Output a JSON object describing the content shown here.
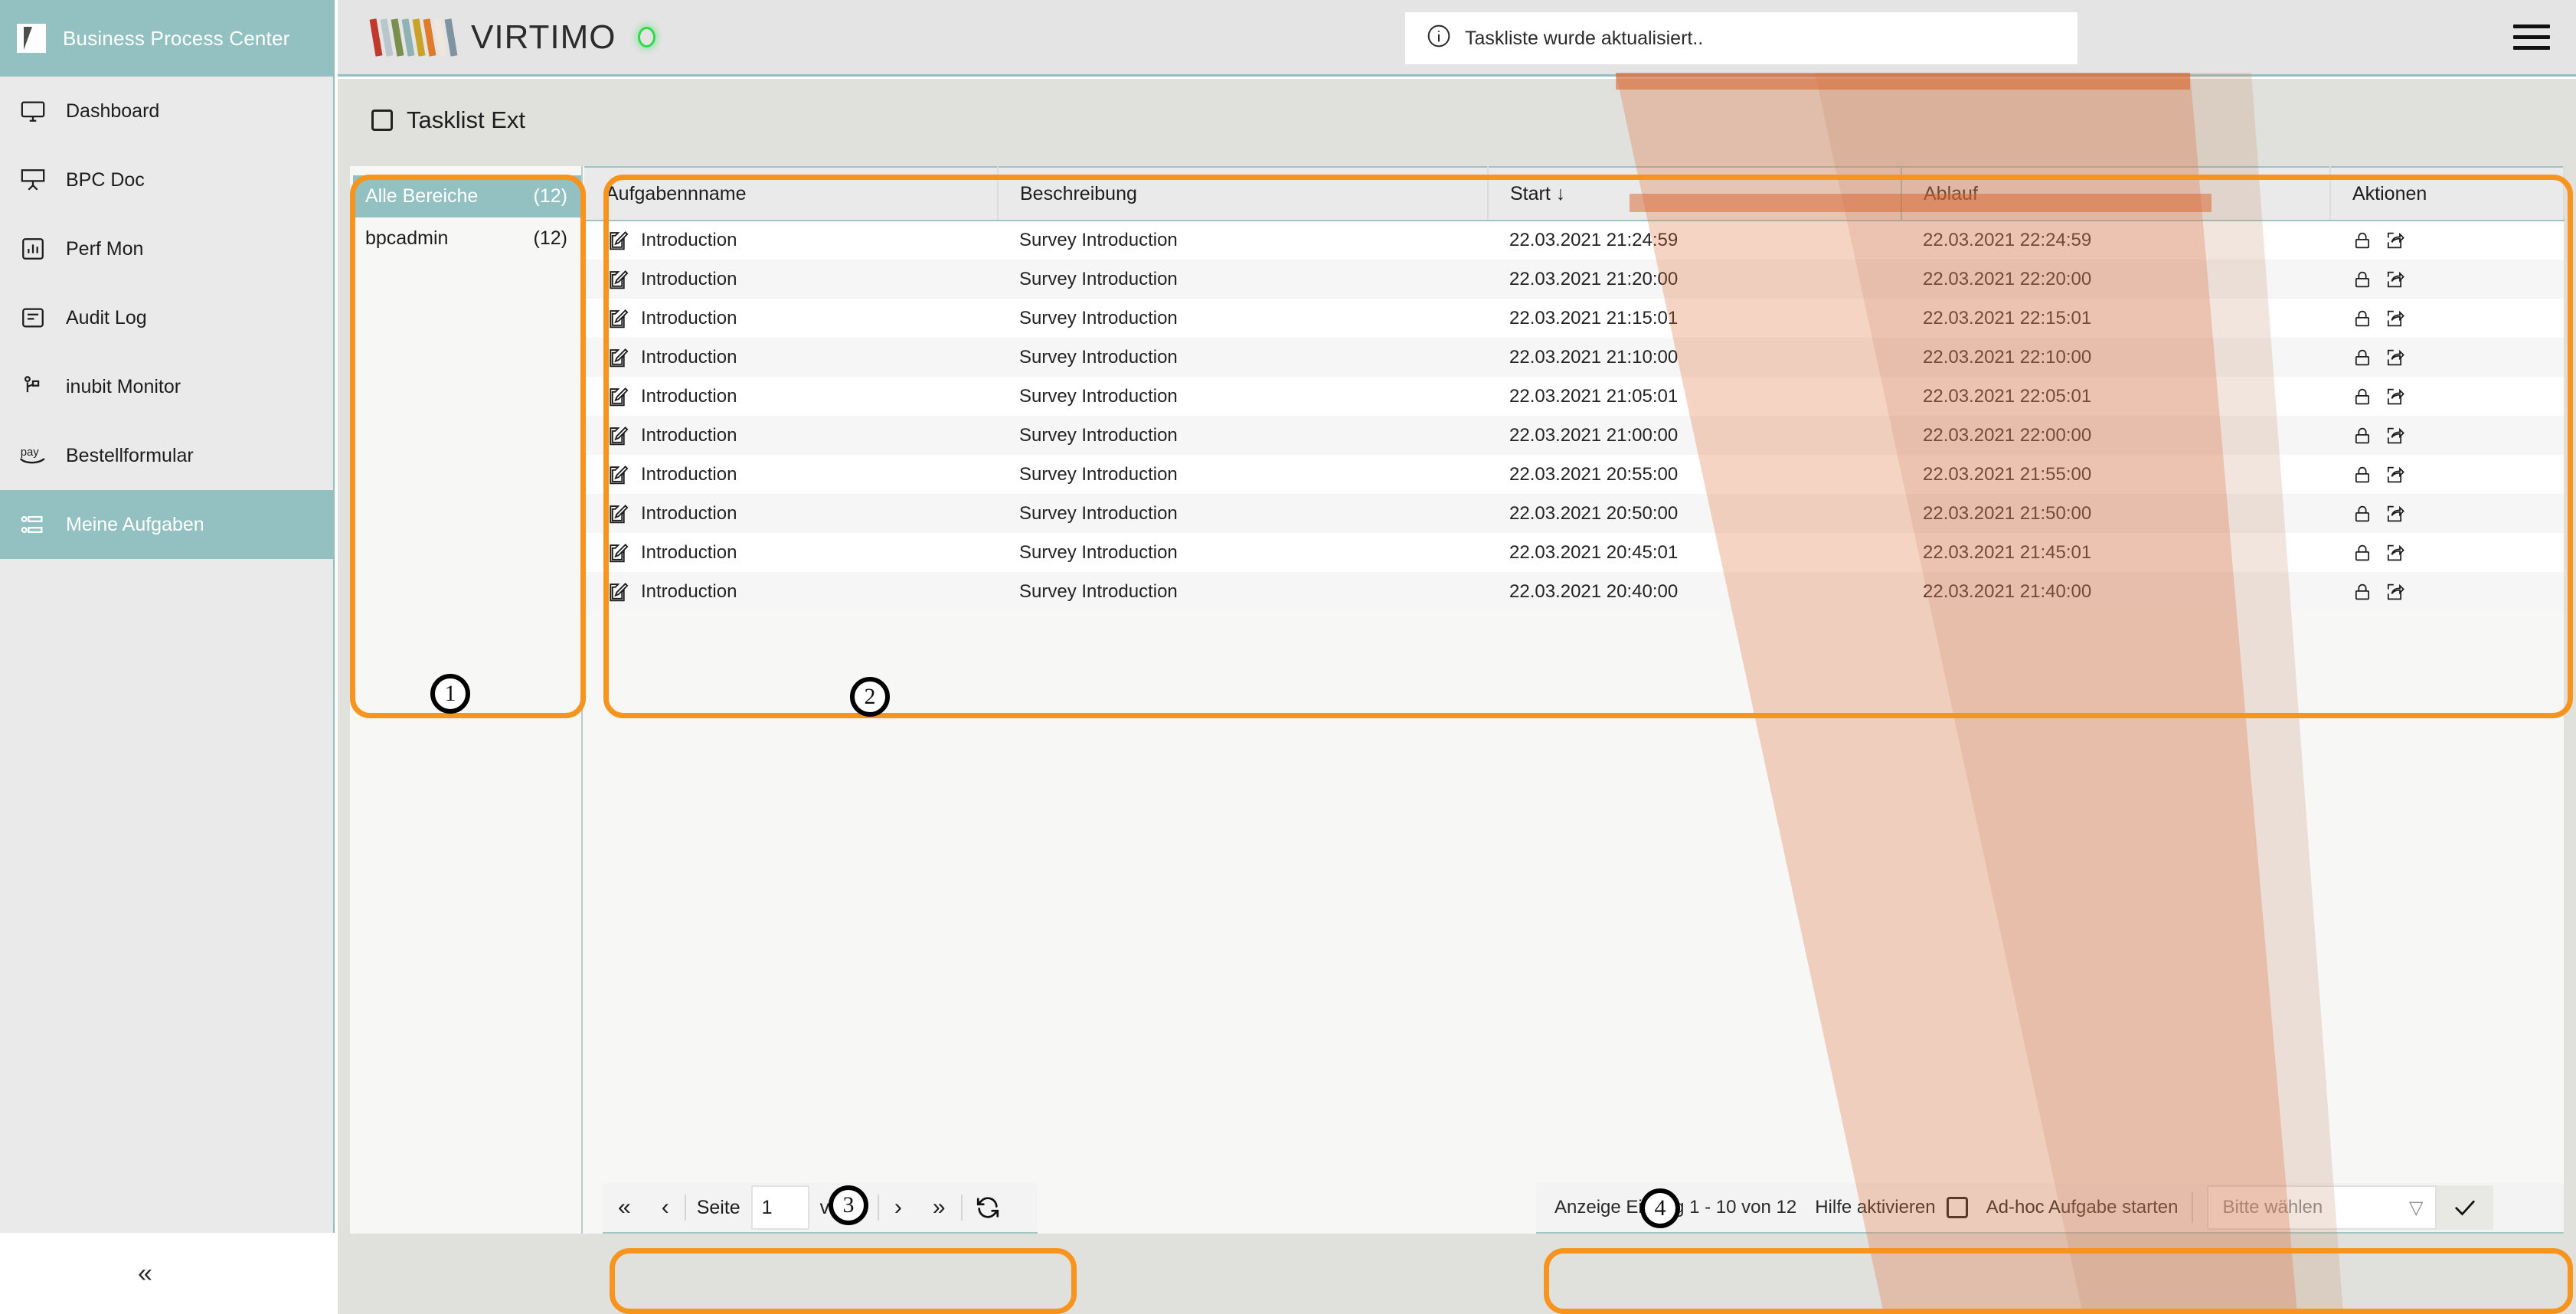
{
  "sidebar": {
    "brand": "Business Process Center",
    "collapse_label": "«",
    "items": [
      {
        "label": "Dashboard",
        "icon": "monitor-icon",
        "active": false
      },
      {
        "label": "BPC Doc",
        "icon": "presentation-icon",
        "active": false
      },
      {
        "label": "Perf Mon",
        "icon": "bar-chart-icon",
        "active": false
      },
      {
        "label": "Audit Log",
        "icon": "log-list-icon",
        "active": false
      },
      {
        "label": "inubit Monitor",
        "icon": "inubit-icon",
        "active": false
      },
      {
        "label": "Bestellformular",
        "icon": "pay-icon",
        "active": false
      },
      {
        "label": "Meine Aufgaben",
        "icon": "tasks-icon",
        "active": true
      }
    ]
  },
  "topbar": {
    "logo_text": "VIRTIMO",
    "status": "online",
    "toast_text": "Taskliste wurde aktualisiert..",
    "toast_icon": "info-icon",
    "menu_icon": "hamburger-icon"
  },
  "page": {
    "title": "Tasklist Ext",
    "settings_icon": "gear-icon"
  },
  "facets": {
    "items": [
      {
        "label": "Alle Bereiche",
        "count": "(12)",
        "active": true
      },
      {
        "label": "bpcadmin",
        "count": "(12)",
        "active": false
      }
    ]
  },
  "table": {
    "columns": [
      "Aufgabennname",
      "Beschreibung",
      "Start",
      "Ablauf",
      "Aktionen"
    ],
    "sorted_column": "Start",
    "sort_indicator": "↓",
    "row_icon": "edit-task-icon",
    "action_icons": [
      "lock-icon",
      "forward-icon"
    ],
    "rows": [
      {
        "name": "Introduction",
        "description": "Survey Introduction",
        "start": "22.03.2021 21:24:59",
        "end": "22.03.2021 22:24:59"
      },
      {
        "name": "Introduction",
        "description": "Survey Introduction",
        "start": "22.03.2021 21:20:00",
        "end": "22.03.2021 22:20:00"
      },
      {
        "name": "Introduction",
        "description": "Survey Introduction",
        "start": "22.03.2021 21:15:01",
        "end": "22.03.2021 22:15:01"
      },
      {
        "name": "Introduction",
        "description": "Survey Introduction",
        "start": "22.03.2021 21:10:00",
        "end": "22.03.2021 22:10:00"
      },
      {
        "name": "Introduction",
        "description": "Survey Introduction",
        "start": "22.03.2021 21:05:01",
        "end": "22.03.2021 22:05:01"
      },
      {
        "name": "Introduction",
        "description": "Survey Introduction",
        "start": "22.03.2021 21:00:00",
        "end": "22.03.2021 22:00:00"
      },
      {
        "name": "Introduction",
        "description": "Survey Introduction",
        "start": "22.03.2021 20:55:00",
        "end": "22.03.2021 21:55:00"
      },
      {
        "name": "Introduction",
        "description": "Survey Introduction",
        "start": "22.03.2021 20:50:00",
        "end": "22.03.2021 21:50:00"
      },
      {
        "name": "Introduction",
        "description": "Survey Introduction",
        "start": "22.03.2021 20:45:01",
        "end": "22.03.2021 21:45:01"
      },
      {
        "name": "Introduction",
        "description": "Survey Introduction",
        "start": "22.03.2021 20:40:00",
        "end": "22.03.2021 21:40:00"
      }
    ]
  },
  "pager": {
    "first_icon": "«",
    "prev_icon": "‹",
    "page_label": "Seite",
    "page_value": "1",
    "of_label": "von 2",
    "next_icon": "›",
    "last_icon": "»",
    "refresh_icon": "refresh-icon"
  },
  "footbar": {
    "entries_text": "Anzeige Eintrag 1 - 10 von 12",
    "help_label": "Hilfe aktivieren",
    "adhoc_label": "Ad-hoc Aufgabe starten",
    "select_placeholder": "Bitte wählen",
    "select_caret": "▽",
    "confirm_icon": "check-icon"
  },
  "annotations": {
    "markers": [
      {
        "id": "1",
        "target": "facets-panel"
      },
      {
        "id": "2",
        "target": "task-table"
      },
      {
        "id": "3",
        "target": "pager-toolbar"
      },
      {
        "id": "4",
        "target": "footer-toolbar"
      }
    ],
    "highlight_color": "#f7941e"
  }
}
